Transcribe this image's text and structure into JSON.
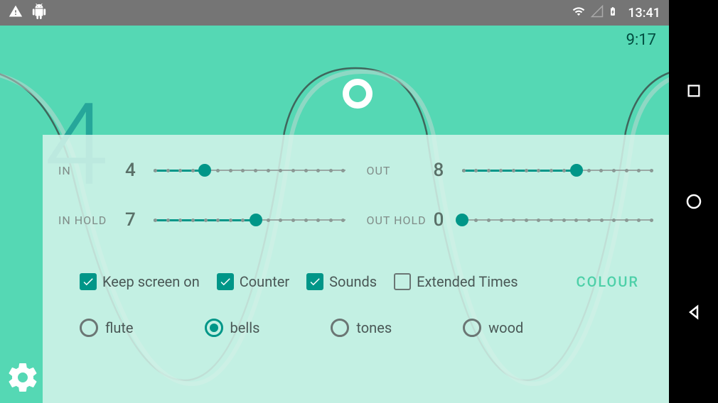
{
  "status": {
    "time": "13:41"
  },
  "session": {
    "elapsed": "9:17",
    "counter": "4"
  },
  "sliders": {
    "in": {
      "label": "IN",
      "value": "4",
      "pos": 4,
      "max": 15
    },
    "out": {
      "label": "OUT",
      "value": "8",
      "pos": 9,
      "max": 15
    },
    "in_hold": {
      "label": "IN HOLD",
      "value": "7",
      "pos": 8,
      "max": 15
    },
    "out_hold": {
      "label": "OUT HOLD",
      "value": "0",
      "pos": 0,
      "max": 15
    }
  },
  "options": {
    "keep_screen": {
      "label": "Keep screen on",
      "checked": true
    },
    "counter": {
      "label": "Counter",
      "checked": true
    },
    "sounds": {
      "label": "Sounds",
      "checked": true
    },
    "extended": {
      "label": "Extended Times",
      "checked": false
    },
    "colour_label": "COLOUR"
  },
  "sounds": {
    "selected": "bells",
    "items": [
      "flute",
      "bells",
      "tones",
      "wood"
    ]
  }
}
